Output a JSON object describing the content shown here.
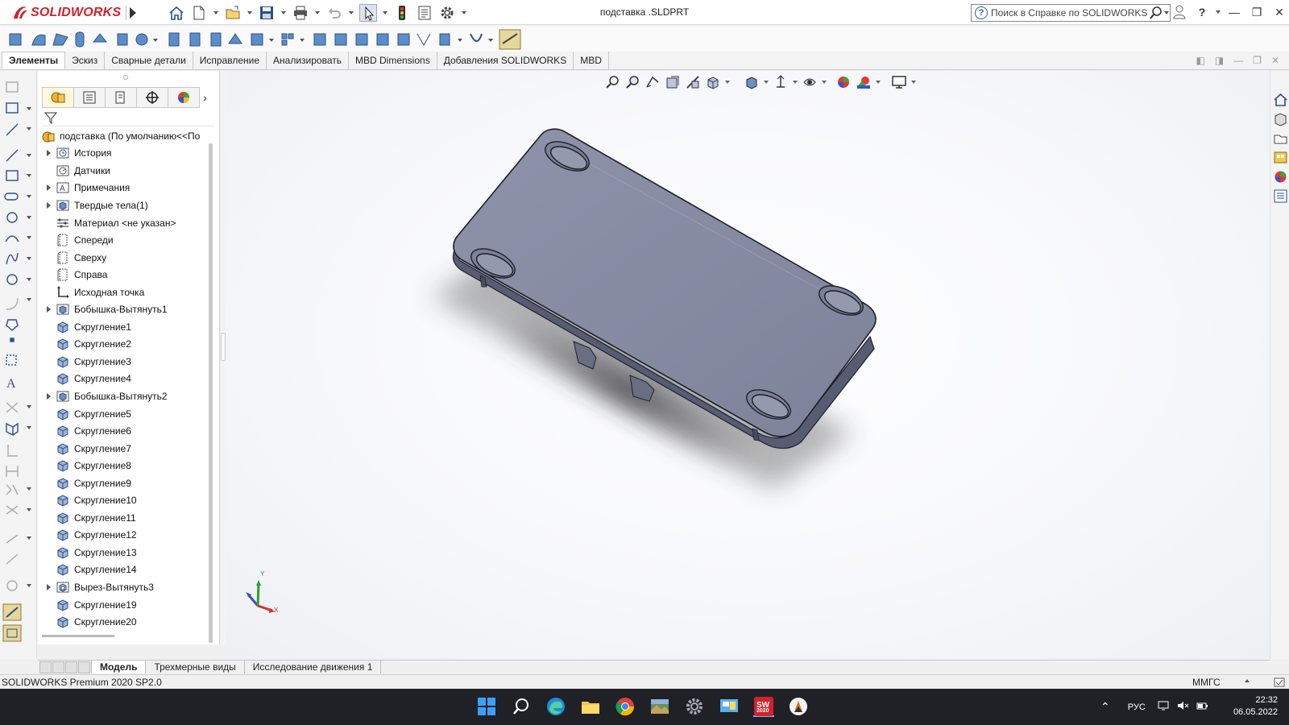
{
  "app": {
    "logo_text": "SOLIDWORKS",
    "document_title": "подставка .SLDPRT",
    "help_search_placeholder": "Поиск в Справке по SOLIDWORKS"
  },
  "command_tabs": [
    {
      "label": "Элементы",
      "active": true
    },
    {
      "label": "Эскиз"
    },
    {
      "label": "Сварные детали"
    },
    {
      "label": "Исправление"
    },
    {
      "label": "Анализировать"
    },
    {
      "label": "MBD Dimensions"
    },
    {
      "label": "Добавления SOLIDWORKS"
    },
    {
      "label": "MBD"
    }
  ],
  "feature_tree": {
    "root": "подставка  (По умолчанию<<По",
    "items": [
      {
        "label": "История",
        "icon": "history-folder-icon",
        "expandable": true
      },
      {
        "label": "Датчики",
        "icon": "sensors-icon",
        "expandable": false
      },
      {
        "label": "Примечания",
        "icon": "annotations-icon",
        "expandable": true
      },
      {
        "label": "Твердые тела(1)",
        "icon": "solid-bodies-icon",
        "expandable": true
      },
      {
        "label": "Материал <не указан>",
        "icon": "material-icon",
        "expandable": false
      },
      {
        "label": "Спереди",
        "icon": "plane-icon",
        "expandable": false
      },
      {
        "label": "Сверху",
        "icon": "plane-icon",
        "expandable": false
      },
      {
        "label": "Справа",
        "icon": "plane-icon",
        "expandable": false
      },
      {
        "label": "Исходная точка",
        "icon": "origin-icon",
        "expandable": false
      },
      {
        "label": "Бобышка-Вытянуть1",
        "icon": "extrude-icon",
        "expandable": true
      },
      {
        "label": "Скругление1",
        "icon": "fillet-icon",
        "expandable": false
      },
      {
        "label": "Скругление2",
        "icon": "fillet-icon",
        "expandable": false
      },
      {
        "label": "Скругление3",
        "icon": "fillet-icon",
        "expandable": false
      },
      {
        "label": "Скругление4",
        "icon": "fillet-icon",
        "expandable": false
      },
      {
        "label": "Бобышка-Вытянуть2",
        "icon": "extrude-icon",
        "expandable": true
      },
      {
        "label": "Скругление5",
        "icon": "fillet-icon",
        "expandable": false
      },
      {
        "label": "Скругление6",
        "icon": "fillet-icon",
        "expandable": false
      },
      {
        "label": "Скругление7",
        "icon": "fillet-icon",
        "expandable": false
      },
      {
        "label": "Скругление8",
        "icon": "fillet-icon",
        "expandable": false
      },
      {
        "label": "Скругление9",
        "icon": "fillet-icon",
        "expandable": false
      },
      {
        "label": "Скругление10",
        "icon": "fillet-icon",
        "expandable": false
      },
      {
        "label": "Скругление11",
        "icon": "fillet-icon",
        "expandable": false
      },
      {
        "label": "Скругление12",
        "icon": "fillet-icon",
        "expandable": false
      },
      {
        "label": "Скругление13",
        "icon": "fillet-icon",
        "expandable": false
      },
      {
        "label": "Скругление14",
        "icon": "fillet-icon",
        "expandable": false
      },
      {
        "label": "Вырез-Вытянуть3",
        "icon": "cut-extrude-icon",
        "expandable": true
      },
      {
        "label": "Скругление19",
        "icon": "fillet-icon",
        "expandable": false
      },
      {
        "label": "Скругление20",
        "icon": "fillet-icon",
        "expandable": false
      }
    ]
  },
  "bottom_tabs": [
    {
      "label": "Модель",
      "active": true
    },
    {
      "label": "Трехмерные виды"
    },
    {
      "label": "Исследование движения 1"
    }
  ],
  "statusbar": {
    "product": "SOLIDWORKS Premium 2020 SP2.0",
    "units": "ММГС"
  },
  "triad": {
    "y_label": "Y",
    "x_label": "X"
  },
  "taskbar": {
    "lang": "РУС",
    "time": "22:32",
    "date": "06.05.2022",
    "sw_badge": "2020"
  },
  "colors": {
    "brand_red": "#d4202a",
    "part_face": "#8a8fa6",
    "part_edge": "#2a2c38",
    "taskbar_bg": "#1f2126"
  }
}
